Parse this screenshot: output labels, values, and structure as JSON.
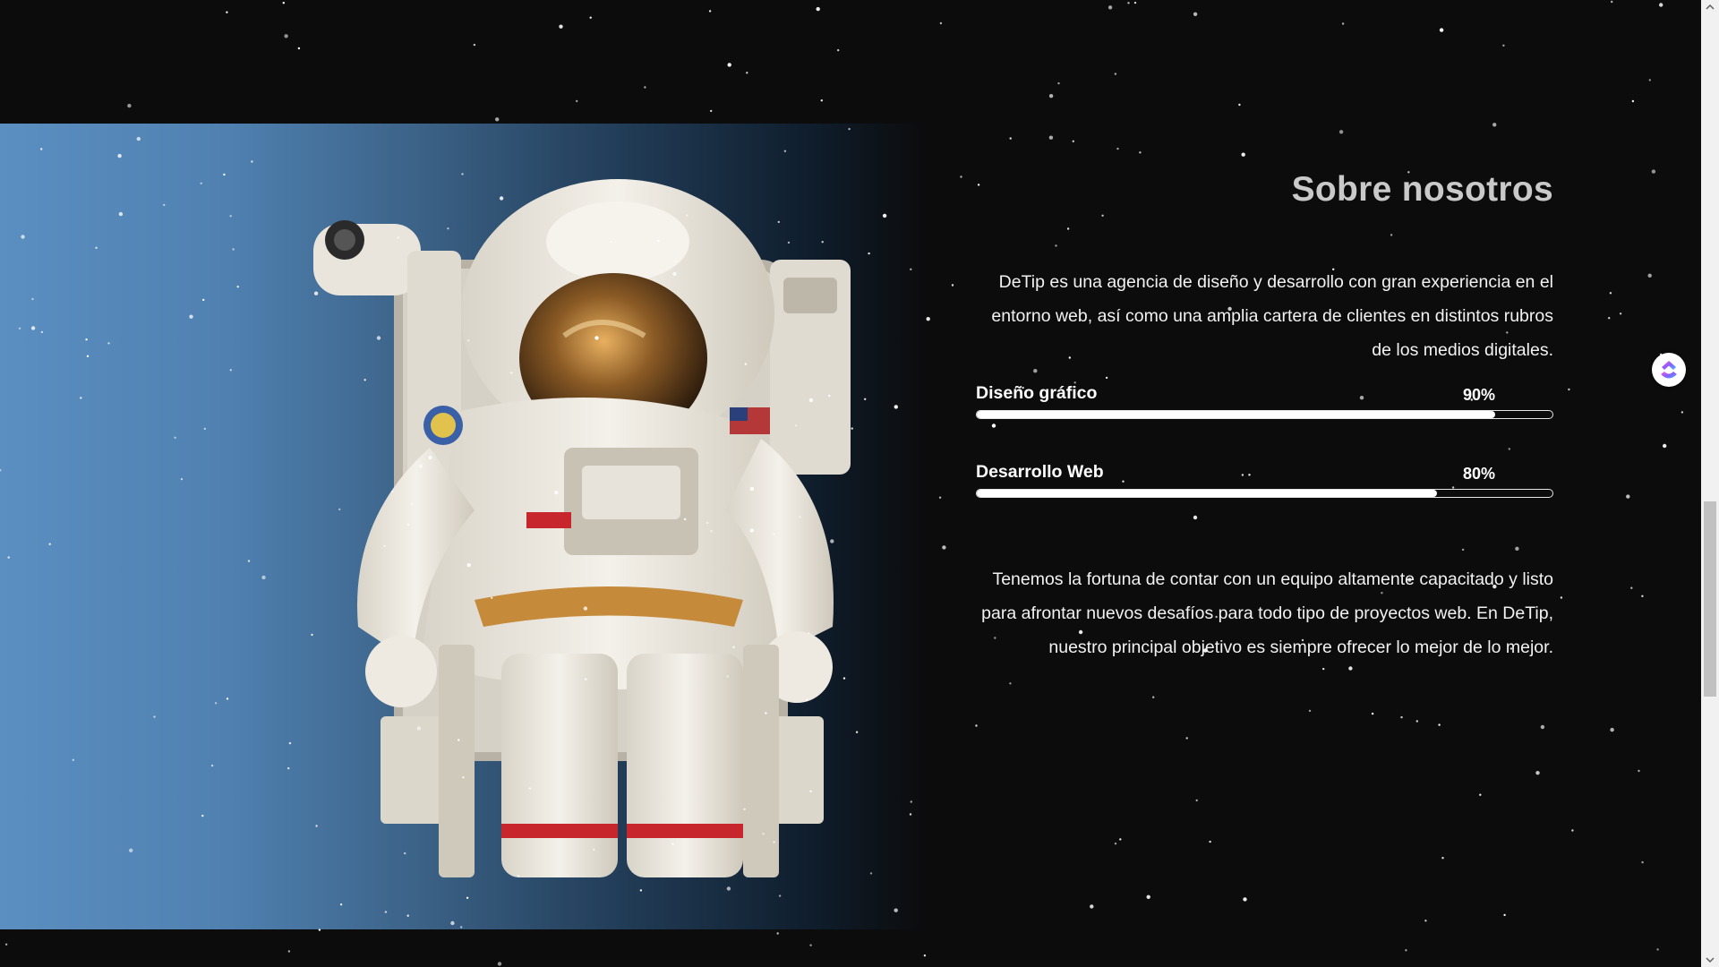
{
  "about": {
    "title": "Sobre nosotros",
    "intro": "DeTip es una agencia de diseño y desarrollo con gran experiencia en el entorno web, así como una amplia cartera de clientes en distintos rubros de los medios digitales.",
    "skills": [
      {
        "label": "Diseño gráfico",
        "percent_label": "90%",
        "value": 0.9
      },
      {
        "label": "Desarrollo Web",
        "percent_label": "80%",
        "value": 0.8
      }
    ],
    "closing": "Tenemos la fortuna de contar con un equipo altamente capacitado y listo para afrontar nuevos desafíos para todo tipo de proyectos web. En DeTip, nuestro principal objetivo es siempre ofrecer lo mejor de lo mejor."
  },
  "media": {
    "image_subject": "astronaut-in-space"
  },
  "widget": {
    "icon": "clickup-logo-icon"
  },
  "colors": {
    "background": "#0c0c0d",
    "title": "#c9c9c9",
    "text": "#f2f2f2",
    "bar": "#ffffff",
    "panel_light": "#5b8fc1",
    "panel_dark": "#0c0c0d"
  },
  "scrollbar": {
    "position_fraction": 0.52
  }
}
